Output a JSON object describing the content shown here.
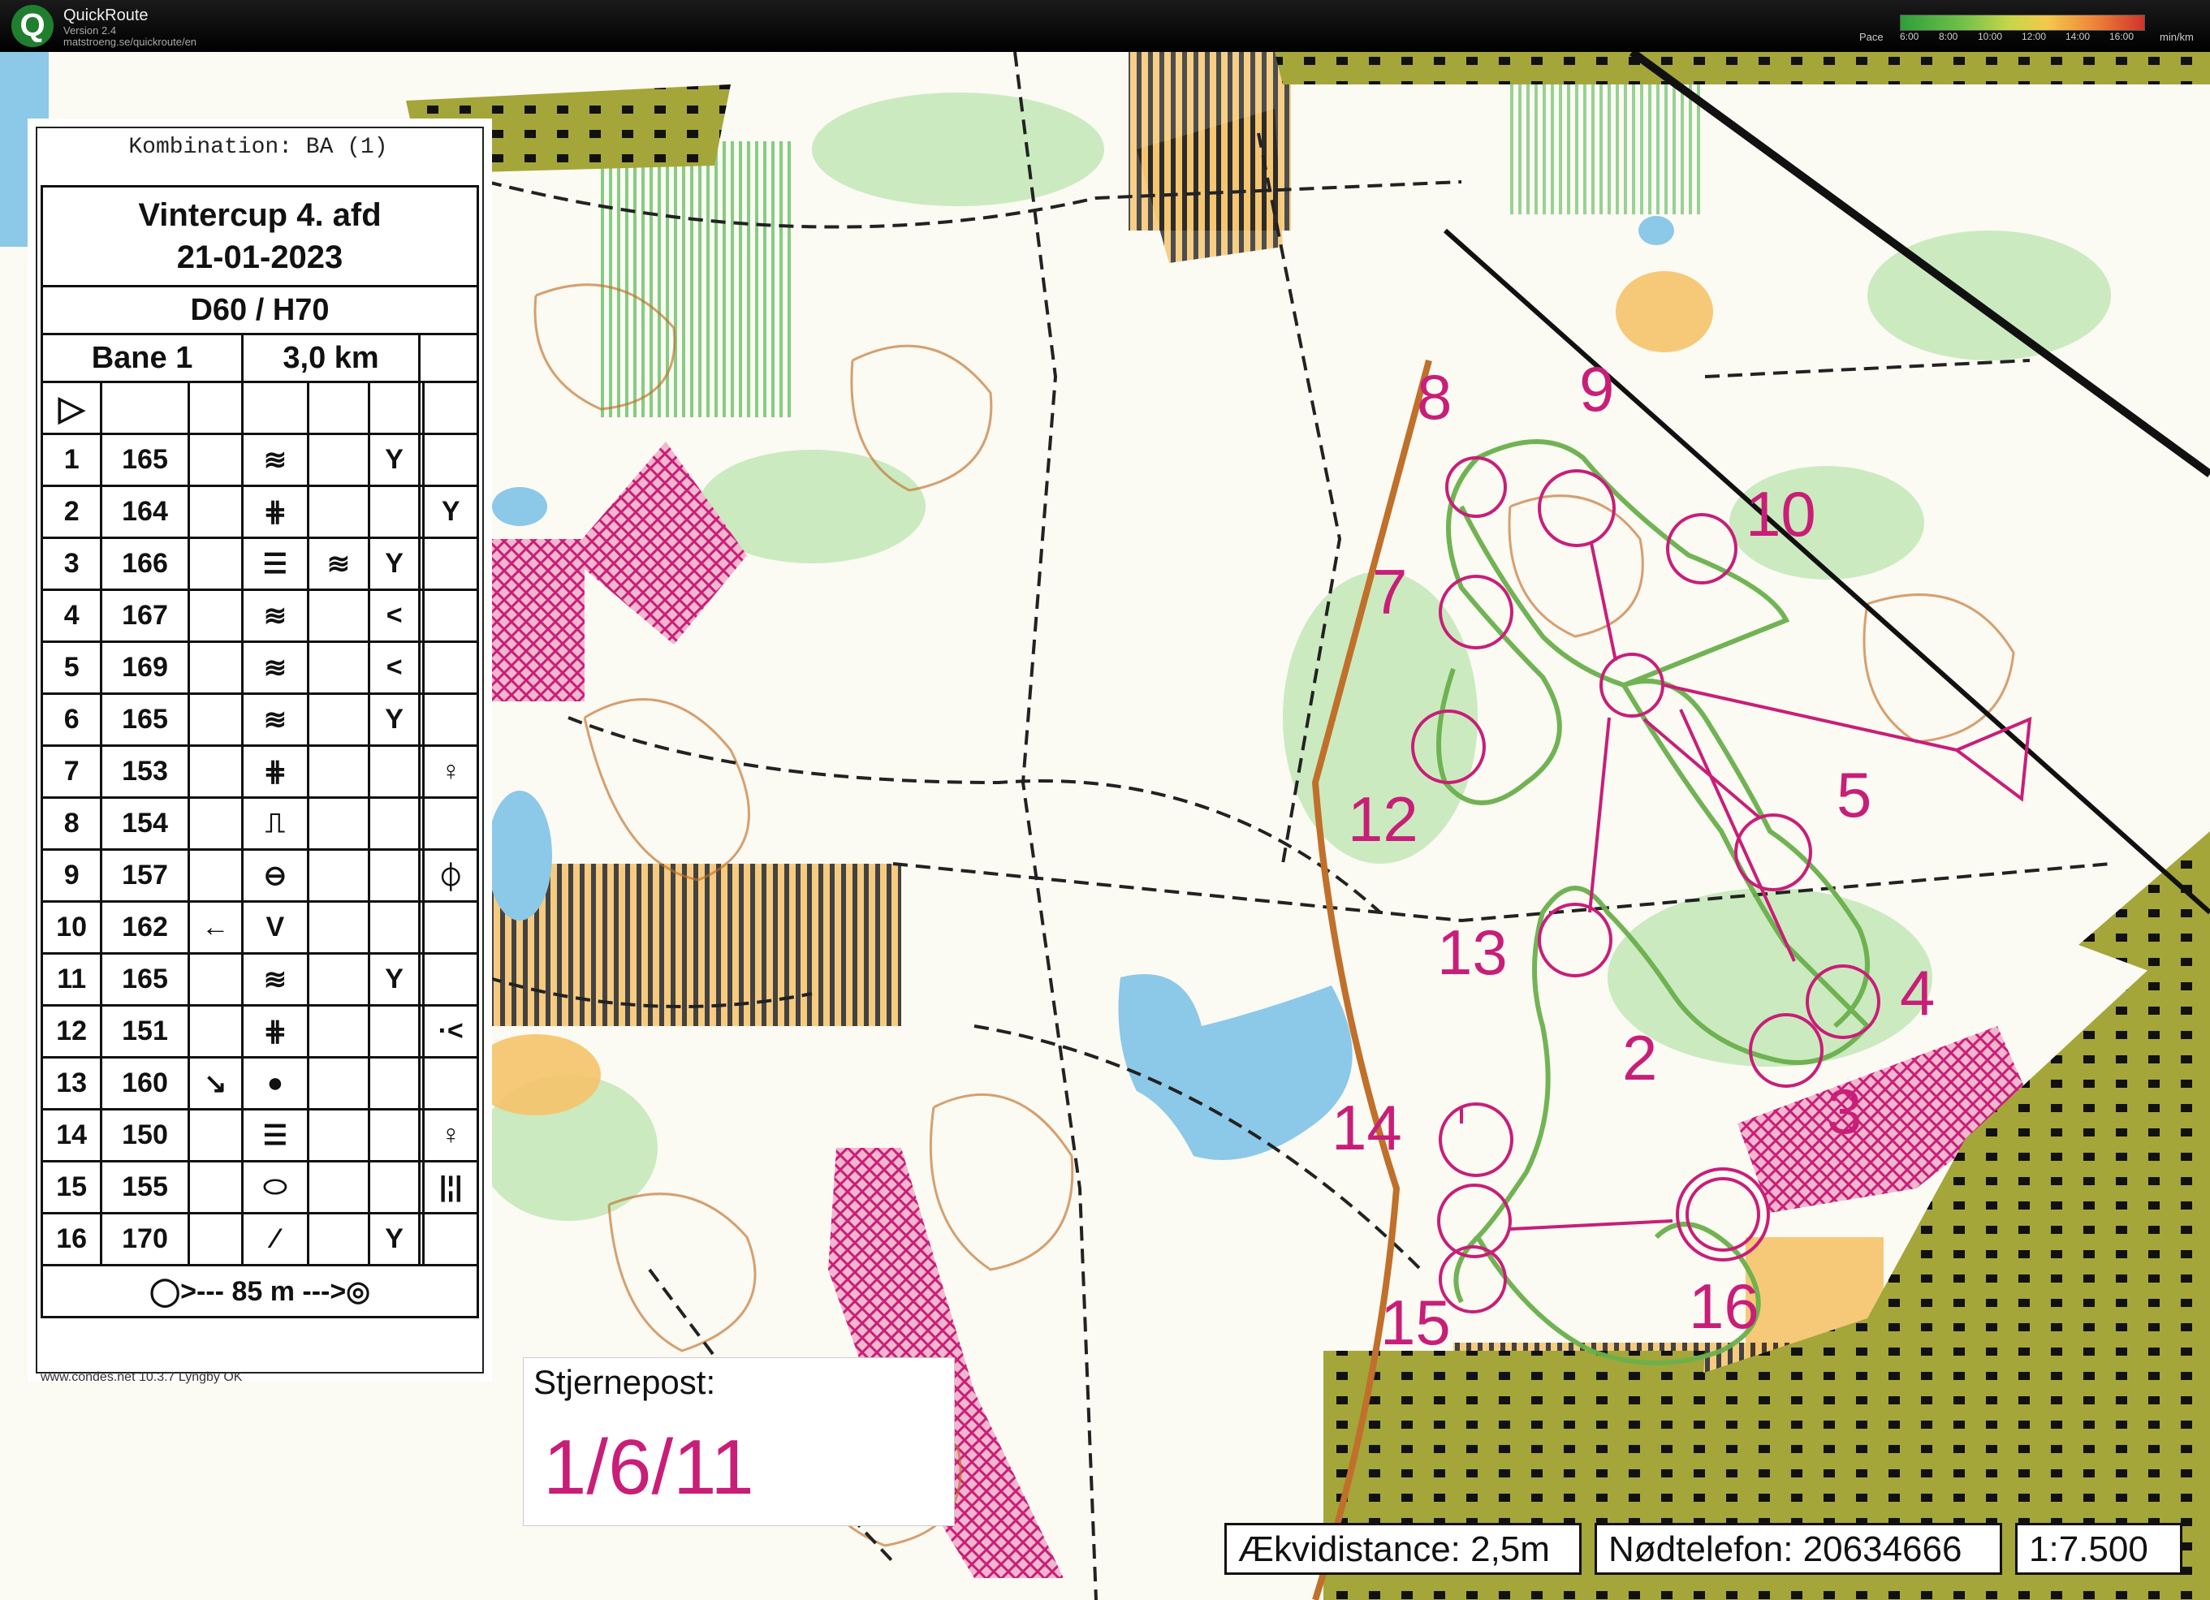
{
  "app": {
    "name": "QuickRoute",
    "version": "Version 2.4",
    "url": "matstroeng.se/quickroute/en",
    "logo": "Q",
    "pace_label": "Pace",
    "pace_ticks": [
      "6:00",
      "8:00",
      "10:00",
      "12:00",
      "14:00",
      "16:00"
    ],
    "pace_unit": "min/km"
  },
  "course": {
    "combination": "Kombination: BA (1)",
    "event": "Vintercup 4. afd",
    "date": "21-01-2023",
    "classes": "D60 / H70",
    "course_name": "Bane 1",
    "length": "3,0 km",
    "controls": [
      {
        "n": "1",
        "code": "165",
        "c": "",
        "d": "≋",
        "e": "",
        "f": "Y",
        "g": ""
      },
      {
        "n": "2",
        "code": "164",
        "c": "",
        "d": "⋕",
        "e": "",
        "f": "",
        "g": "Y"
      },
      {
        "n": "3",
        "code": "166",
        "c": "",
        "d": "☰",
        "e": "≋",
        "f": "Y",
        "g": ""
      },
      {
        "n": "4",
        "code": "167",
        "c": "",
        "d": "≋",
        "e": "",
        "f": "<",
        "g": ""
      },
      {
        "n": "5",
        "code": "169",
        "c": "",
        "d": "≋",
        "e": "",
        "f": "<",
        "g": ""
      },
      {
        "n": "6",
        "code": "165",
        "c": "",
        "d": "≋",
        "e": "",
        "f": "Y",
        "g": ""
      },
      {
        "n": "7",
        "code": "153",
        "c": "",
        "d": "⋕",
        "e": "",
        "f": "",
        "g": "♀"
      },
      {
        "n": "8",
        "code": "154",
        "c": "",
        "d": "⎍",
        "e": "",
        "f": "",
        "g": ""
      },
      {
        "n": "9",
        "code": "157",
        "c": "",
        "d": "⊖",
        "e": "",
        "f": "",
        "g": "⏀"
      },
      {
        "n": "10",
        "code": "162",
        "c": "←",
        "d": "V",
        "e": "",
        "f": "",
        "g": ""
      },
      {
        "n": "11",
        "code": "165",
        "c": "",
        "d": "≋",
        "e": "",
        "f": "Y",
        "g": ""
      },
      {
        "n": "12",
        "code": "151",
        "c": "",
        "d": "⋕",
        "e": "",
        "f": "",
        "g": "·<"
      },
      {
        "n": "13",
        "code": "160",
        "c": "↘",
        "d": "●",
        "e": "",
        "f": "",
        "g": ""
      },
      {
        "n": "14",
        "code": "150",
        "c": "",
        "d": "☰",
        "e": "",
        "f": "",
        "g": "♀"
      },
      {
        "n": "15",
        "code": "155",
        "c": "",
        "d": "⬭",
        "e": "",
        "f": "",
        "g": "|¦|"
      },
      {
        "n": "16",
        "code": "170",
        "c": "",
        "d": "⁄",
        "e": "",
        "f": "Y",
        "g": ""
      }
    ],
    "finish": "85 m",
    "finish_left": "◯>---",
    "finish_right": "--->◎",
    "start_symbol": "▷"
  },
  "footer": {
    "star_label": "Stjernepost:",
    "star_value": "1/6/11",
    "contour": "Ækvidistance: 2,5m",
    "phone": "Nødtelefon: 20634666",
    "scale": "1:7.500",
    "credit": "www.condes.net 10.3.7 Lyngby OK"
  },
  "control_labels": [
    "2",
    "3",
    "4",
    "5",
    "7",
    "8",
    "9",
    "10",
    "12",
    "13",
    "14",
    "15",
    "16"
  ],
  "colors": {
    "course": "#c81e78",
    "route": "#6ab04c",
    "forest_white": "#fbfaf3",
    "green": "#bfe6b3",
    "yellow": "#f5c36b",
    "water": "#8cc8e8",
    "urban": "#8c8c28",
    "contour": "#c0702a"
  }
}
